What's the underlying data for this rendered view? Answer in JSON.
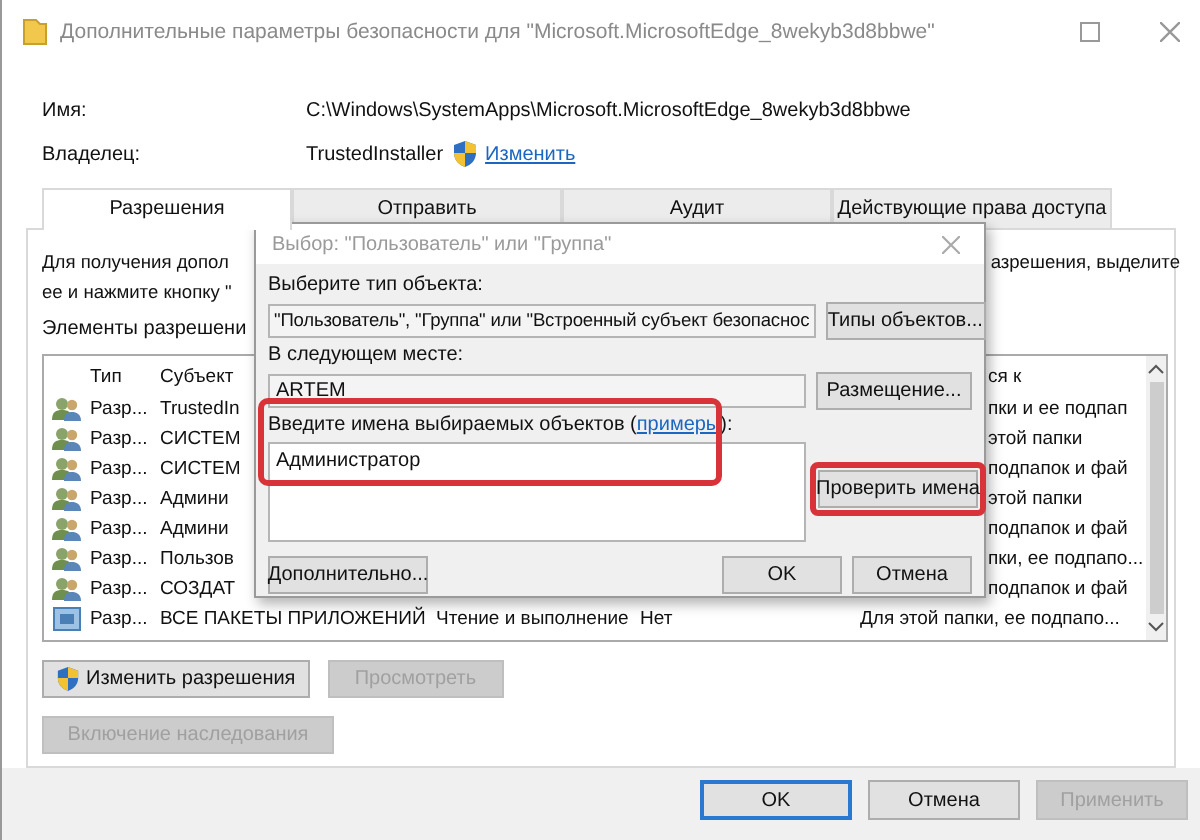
{
  "window": {
    "title": "Дополнительные параметры безопасности  для \"Microsoft.MicrosoftEdge_8wekyb3d8bbwe\""
  },
  "properties": [
    {
      "label": "Имя:",
      "value": "C:\\Windows\\SystemApps\\Microsoft.MicrosoftEdge_8wekyb3d8bbwe"
    },
    {
      "label": "Владелец:",
      "value": "TrustedInstaller",
      "link": "Изменить"
    }
  ],
  "tabs": [
    {
      "label": "Разрешения",
      "selected": true
    },
    {
      "label": "Отправить",
      "selected": false
    },
    {
      "label": "Аудит",
      "selected": false
    },
    {
      "label": "Действующие права доступа",
      "selected": false
    }
  ],
  "description": {
    "line_1_start": "Для получения допол",
    "line_1_end": "азрешения, выделите",
    "line_2_start": "ее и нажмите кнопку \""
  },
  "entries_label": "Элементы разрешени",
  "permissions": {
    "columns": [
      "Тип",
      "Субъект"
    ],
    "column_end": "ся к",
    "rows": [
      {
        "kind": "group",
        "type": "Разр...",
        "subject": "TrustedIn",
        "applies": "пки и ее подпап"
      },
      {
        "kind": "group",
        "type": "Разр...",
        "subject": "СИСТЕМ",
        "applies": "этой папки"
      },
      {
        "kind": "group",
        "type": "Разр...",
        "subject": "СИСТЕМ",
        "applies": "подпапок и фай"
      },
      {
        "kind": "group",
        "type": "Разр...",
        "subject": "Админи",
        "applies": "этой папки"
      },
      {
        "kind": "group",
        "type": "Разр...",
        "subject": "Админи",
        "applies": "подпапок и фай"
      },
      {
        "kind": "group",
        "type": "Разр...",
        "subject": "Пользов",
        "applies": "пки, ее подпапо..."
      },
      {
        "kind": "group",
        "type": "Разр...",
        "subject": "СОЗДАТ",
        "applies": "подпапок и фай"
      },
      {
        "kind": "package",
        "type": "Разр...",
        "subject": "ВСЕ ПАКЕТЫ ПРИЛОЖЕНИЙ",
        "access": "Чтение и выполнение",
        "inherited": "Нет",
        "applies": "Для этой папки, ее подпапо..."
      }
    ]
  },
  "panel_buttons": [
    {
      "label": "Изменить разрешения",
      "shield": true,
      "disabled": false
    },
    {
      "label": "Просмотреть",
      "shield": false,
      "disabled": true
    }
  ],
  "inherit_button": {
    "label": "Включение наследования",
    "disabled": true
  },
  "footer_buttons": [
    {
      "label": "OK",
      "default": true,
      "disabled": false
    },
    {
      "label": "Отмена",
      "default": false,
      "disabled": false
    },
    {
      "label": "Применить",
      "default": false,
      "disabled": true
    }
  ],
  "dialog": {
    "title": "Выбор: \"Пользователь\" или \"Группа\"",
    "object_type": {
      "label": "Выберите тип объекта:",
      "value": "\"Пользователь\", \"Группа\" или \"Встроенный субъект безопаснос",
      "button": "Типы объектов..."
    },
    "location": {
      "label": "В следующем месте:",
      "value": "ARTEM",
      "button": "Размещение..."
    },
    "names": {
      "label_start": "Введите имена выбираемых объектов (",
      "link": "примеры",
      "label_end": "):",
      "value": "Администратор",
      "highlighted": true
    },
    "check_button": {
      "label": "Проверить имена",
      "highlighted": true
    },
    "advanced_button": "Дополнительно...",
    "buttons": [
      "OK",
      "Отмена"
    ]
  }
}
